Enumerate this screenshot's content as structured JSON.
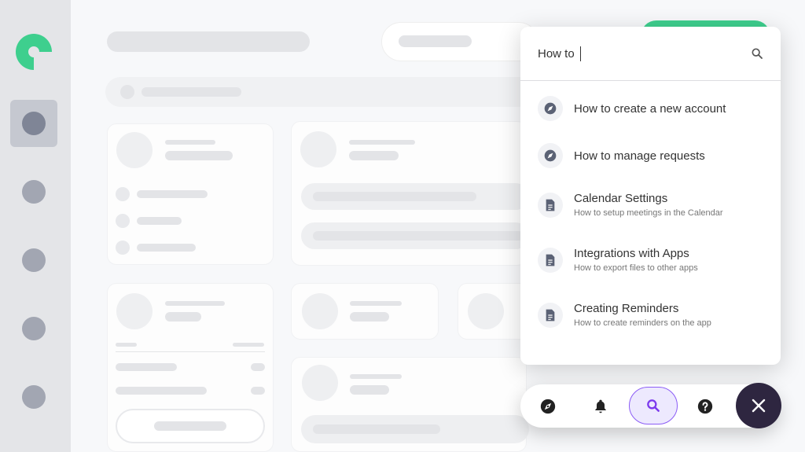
{
  "search": {
    "value": "How to",
    "icon": "search-icon"
  },
  "results": [
    {
      "title": "How to create a new account",
      "subtitle": "",
      "icon": "compass-icon"
    },
    {
      "title": "How to manage requests",
      "subtitle": "",
      "icon": "compass-icon"
    },
    {
      "title": "Calendar Settings",
      "subtitle": "How to setup meetings in the Calendar",
      "icon": "document-icon"
    },
    {
      "title": "Integrations with Apps",
      "subtitle": "How to export files to other apps",
      "icon": "document-icon"
    },
    {
      "title": "Creating Reminders",
      "subtitle": "How to create reminders on the app",
      "icon": "document-icon"
    }
  ],
  "toolbar": {
    "items": [
      "compass-icon",
      "bell-icon",
      "search-icon",
      "help-icon"
    ],
    "active": "search-icon",
    "close": "close-icon"
  },
  "colors": {
    "brand": "#3ecf8e",
    "accent": "#7c3aed",
    "accent_bg": "#ede9fe",
    "dark": "#2e2640"
  }
}
